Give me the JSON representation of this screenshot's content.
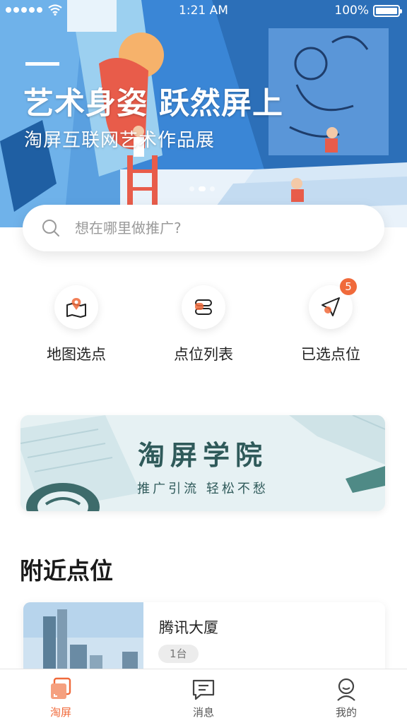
{
  "status_bar": {
    "time": "1:21 AM",
    "battery": "100%",
    "battery_level": 1.0
  },
  "hero": {
    "title": "艺术身姿 跃然屏上",
    "subtitle": "淘屏互联网艺术作品展",
    "slide_count": 3,
    "active_slide": 1
  },
  "search": {
    "placeholder": "想在哪里做推广?",
    "value": "",
    "icon": "search-icon"
  },
  "actions": [
    {
      "label": "地图选点",
      "icon": "map-pin-icon"
    },
    {
      "label": "点位列表",
      "icon": "list-icon"
    },
    {
      "label": "已选点位",
      "icon": "send-icon",
      "badge": "5"
    }
  ],
  "academy": {
    "title": "淘屏学院",
    "subtitle": "推广引流  轻松不愁"
  },
  "nearby": {
    "title": "附近点位",
    "items": [
      {
        "name": "腾讯大厦",
        "tag": "1台"
      }
    ]
  },
  "tabbar": {
    "tabs": [
      {
        "label": "淘屏",
        "icon": "screens-icon",
        "active": true
      },
      {
        "label": "消息",
        "icon": "chat-icon",
        "active": false
      },
      {
        "label": "我的",
        "icon": "user-icon",
        "active": false
      }
    ]
  },
  "colors": {
    "accent": "#f06a3b",
    "academy_text": "#2f5a5a",
    "hero_blue": "#2e7bd0"
  }
}
